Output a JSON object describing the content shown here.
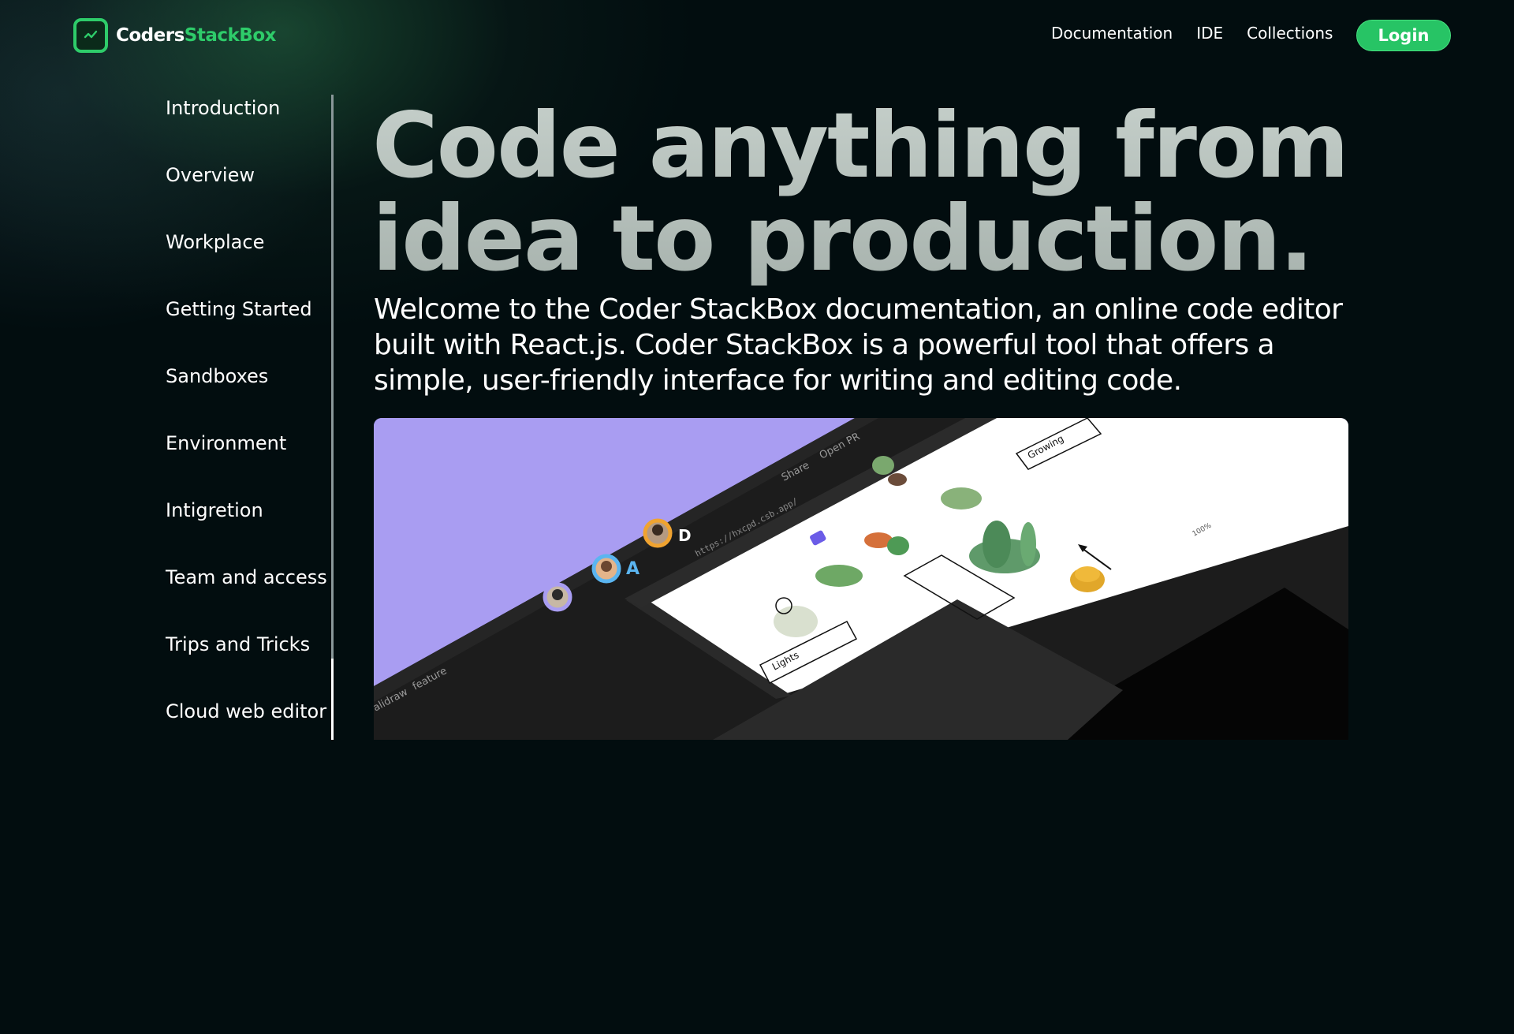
{
  "header": {
    "logo": {
      "part1": "Coders",
      "part2": "StackBox"
    },
    "nav": [
      {
        "label": "Documentation"
      },
      {
        "label": "IDE"
      },
      {
        "label": "Collections"
      }
    ],
    "login_label": "Login"
  },
  "sidebar": {
    "items": [
      {
        "label": "Introduction"
      },
      {
        "label": "Overview"
      },
      {
        "label": "Workplace"
      },
      {
        "label": "Getting Started"
      },
      {
        "label": "Sandboxes"
      },
      {
        "label": "Environment"
      },
      {
        "label": "Intigretion"
      },
      {
        "label": "Team and access"
      },
      {
        "label": "Trips and Tricks"
      },
      {
        "label": "Cloud web editor"
      }
    ],
    "active_item": "Cloud web editor"
  },
  "main": {
    "title_line1": "Code anything from",
    "title_line2": "idea to production.",
    "description": "Welcome to the Coder StackBox documentation, an online code editor built with React.js. Coder StackBox is a powerful tool that offers a simple, user-friendly interface for writing and editing code.",
    "hero_image": {
      "url_bar": "https://hxcpd.csb.app/",
      "share_label": "Share",
      "open_pr_label": "Open PR",
      "branch_label": "feature",
      "project_label": "alidraw",
      "zoom_label": "100%",
      "card_label_1": "Growing",
      "card_label_2": "Lights",
      "avatar_initials": [
        "D",
        "A"
      ]
    }
  },
  "colors": {
    "accent_green": "#2ecc6a",
    "background": "#020d0f",
    "hero_bg": "#a99df2",
    "title_gray": "#b3bcb8"
  }
}
